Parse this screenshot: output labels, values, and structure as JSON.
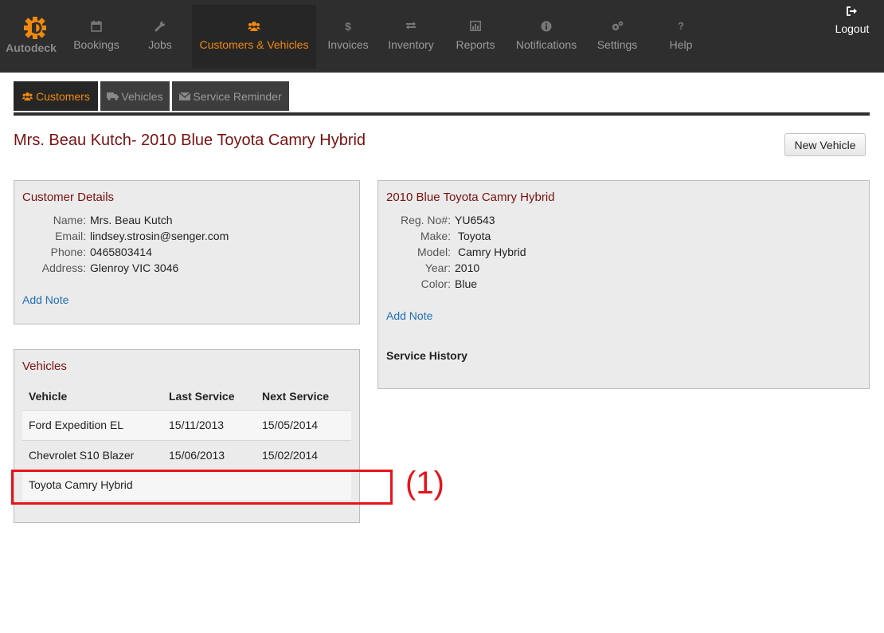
{
  "app": {
    "name": "Autodeck"
  },
  "nav": {
    "bookings": "Bookings",
    "jobs": "Jobs",
    "customers_vehicles": "Customers & Vehicles",
    "invoices": "Invoices",
    "inventory": "Inventory",
    "reports": "Reports",
    "notifications": "Notifications",
    "settings": "Settings",
    "help": "Help",
    "logout": "Logout"
  },
  "subtabs": {
    "customers": "Customers",
    "vehicles": "Vehicles",
    "service_reminder": "Service Reminder"
  },
  "page": {
    "title": "Mrs. Beau Kutch- 2010 Blue Toyota Camry Hybrid",
    "new_vehicle_button": "New Vehicle"
  },
  "customer_details": {
    "title": "Customer Details",
    "name_label": "Name:",
    "name": "Mrs. Beau Kutch",
    "email_label": "Email:",
    "email": "lindsey.strosin@senger.com",
    "phone_label": "Phone:",
    "phone": "0465803414",
    "address_label": "Address:",
    "address": "Glenroy VIC 3046",
    "add_note": "Add Note"
  },
  "vehicles_panel": {
    "title": "Vehicles",
    "headers": {
      "vehicle": "Vehicle",
      "last_service": "Last Service",
      "next_service": "Next Service"
    },
    "rows": [
      {
        "vehicle": "Ford Expedition EL",
        "last_service": "15/11/2013",
        "next_service": "15/05/2014"
      },
      {
        "vehicle": "Chevrolet S10 Blazer",
        "last_service": "15/06/2013",
        "next_service": "15/02/2014"
      },
      {
        "vehicle": "Toyota Camry Hybrid",
        "last_service": "",
        "next_service": ""
      }
    ]
  },
  "vehicle_details": {
    "title": "2010 Blue Toyota Camry Hybrid",
    "reg_label": "Reg. No#:",
    "reg": "YU6543",
    "make_label": "Make:",
    "make": "Toyota",
    "model_label": "Model:",
    "model": "Camry Hybrid",
    "year_label": "Year:",
    "year": "2010",
    "color_label": "Color:",
    "color": "Blue",
    "add_note": "Add Note",
    "service_history": "Service History"
  },
  "annotation": {
    "label": "(1)"
  },
  "colors": {
    "accent": "#f0890e",
    "title_red": "#7a1010",
    "link_blue": "#1f6fb5",
    "annotation_red": "#e8131a"
  }
}
